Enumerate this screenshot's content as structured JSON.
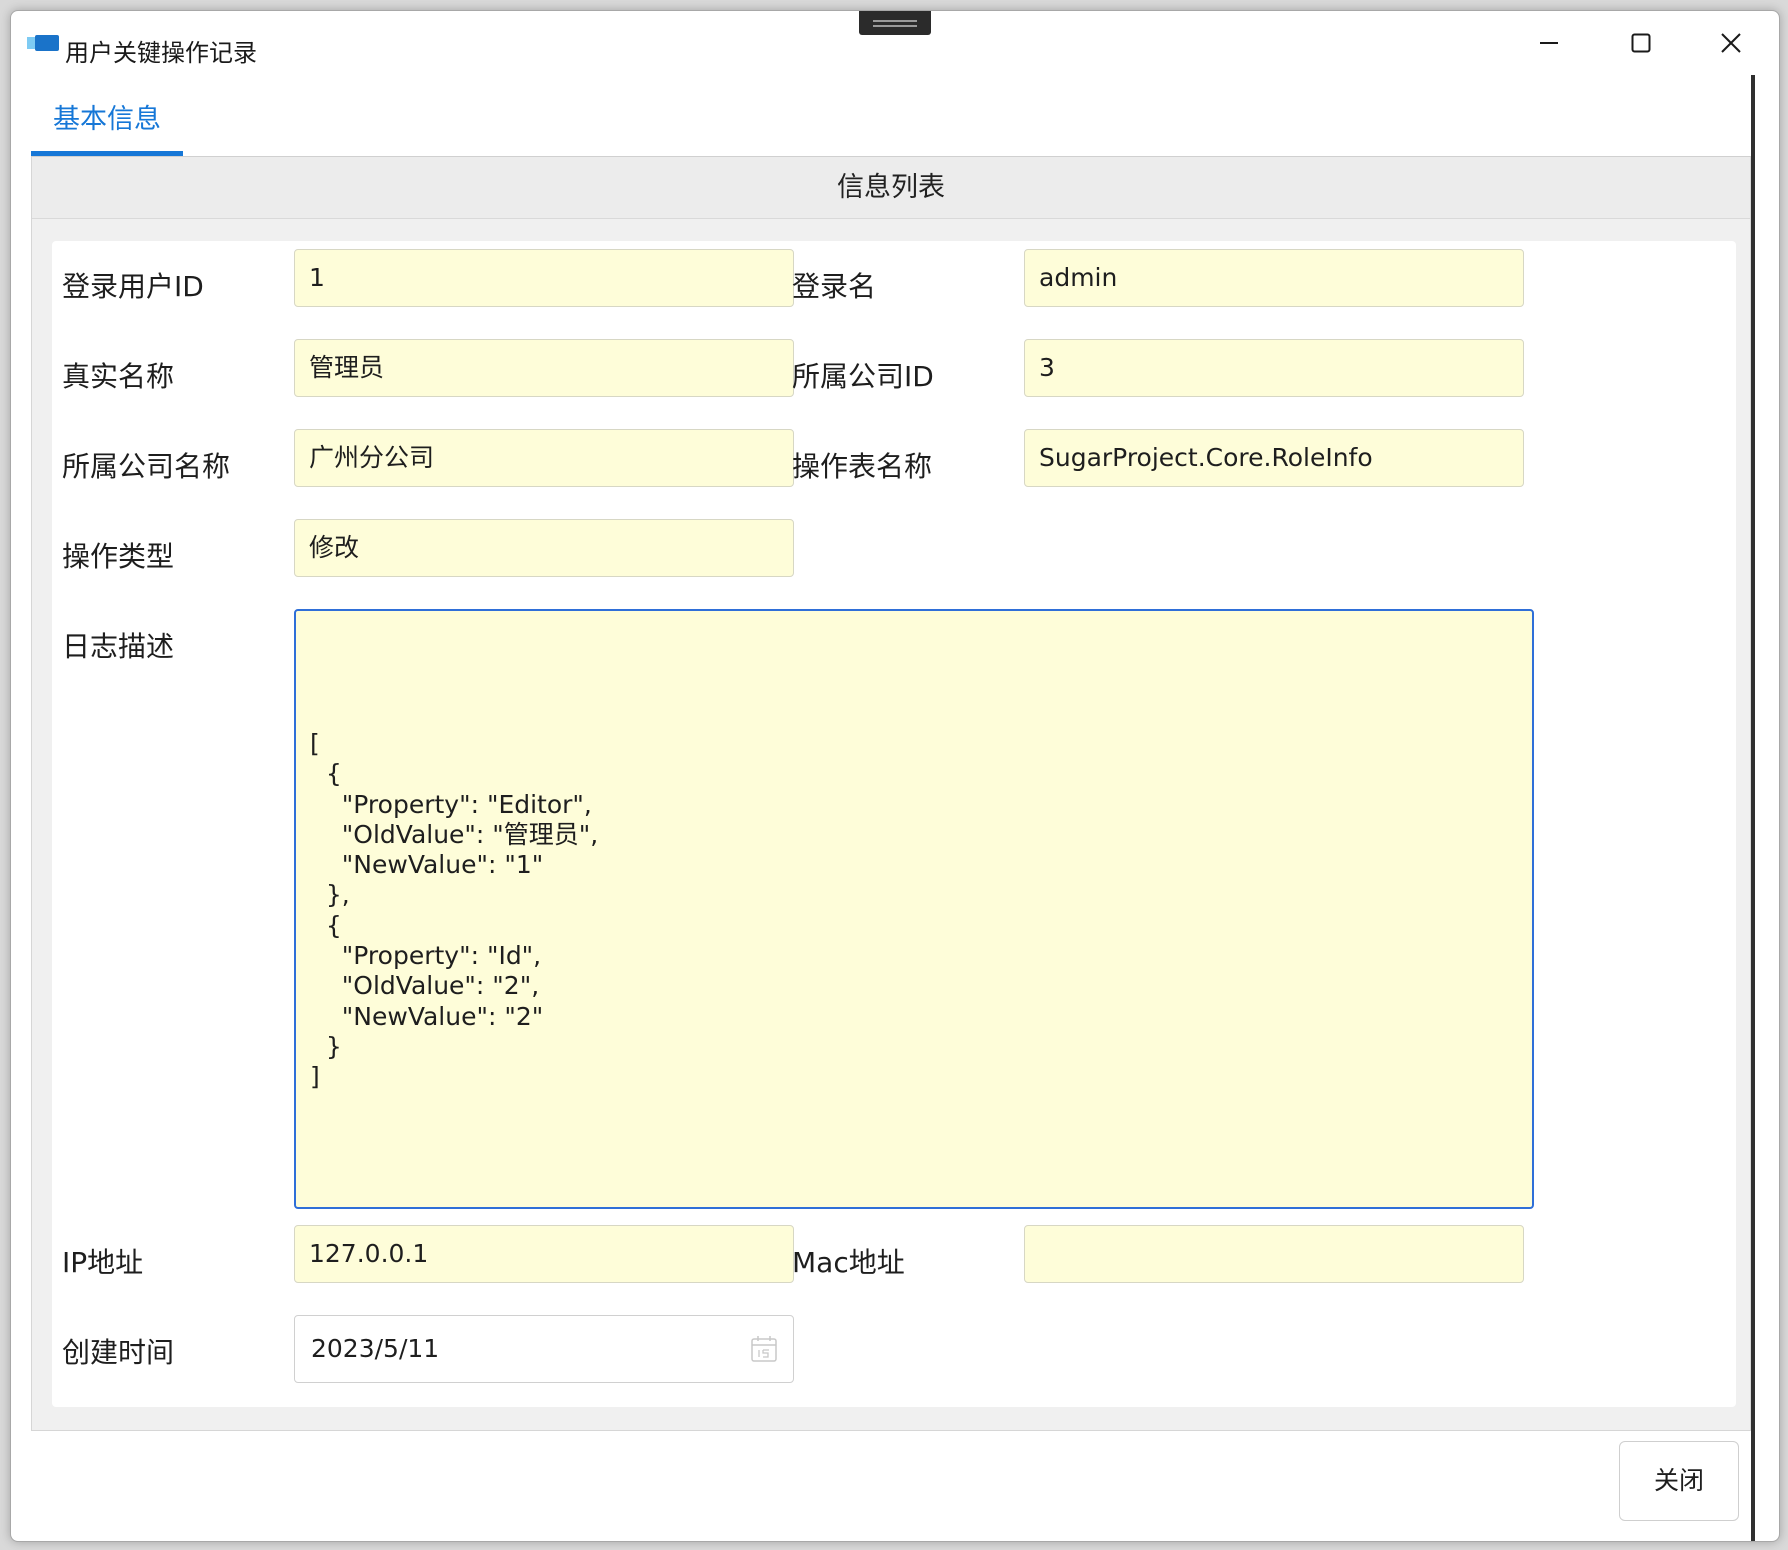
{
  "window": {
    "title": "用户关键操作记录"
  },
  "tabs": [
    {
      "label": "基本信息",
      "active": true
    }
  ],
  "group": {
    "header": "信息列表"
  },
  "form": {
    "login_user_id": {
      "label": "登录用户ID",
      "value": "1"
    },
    "login_name": {
      "label": "登录名",
      "value": "admin"
    },
    "real_name": {
      "label": "真实名称",
      "value": "管理员"
    },
    "company_id": {
      "label": "所属公司ID",
      "value": "3"
    },
    "company_name": {
      "label": "所属公司名称",
      "value": "广州分公司"
    },
    "table_name": {
      "label": "操作表名称",
      "value": "SugarProject.Core.RoleInfo"
    },
    "operation_type": {
      "label": "操作类型",
      "value": "修改"
    },
    "log_description": {
      "label": "日志描述",
      "value": "[\n  {\n    \"Property\": \"Editor\",\n    \"OldValue\": \"管理员\",\n    \"NewValue\": \"1\"\n  },\n  {\n    \"Property\": \"Id\",\n    \"OldValue\": \"2\",\n    \"NewValue\": \"2\"\n  }\n]"
    },
    "ip_address": {
      "label": "IP地址",
      "value": "127.0.0.1"
    },
    "mac_address": {
      "label": "Mac地址",
      "value": ""
    },
    "created_time": {
      "label": "创建时间",
      "value": "2023/5/11"
    }
  },
  "footer": {
    "close_label": "关闭"
  },
  "colors": {
    "accent": "#1677d7",
    "field_background": "#fefdd9",
    "focus_border": "#2f6fd8"
  }
}
